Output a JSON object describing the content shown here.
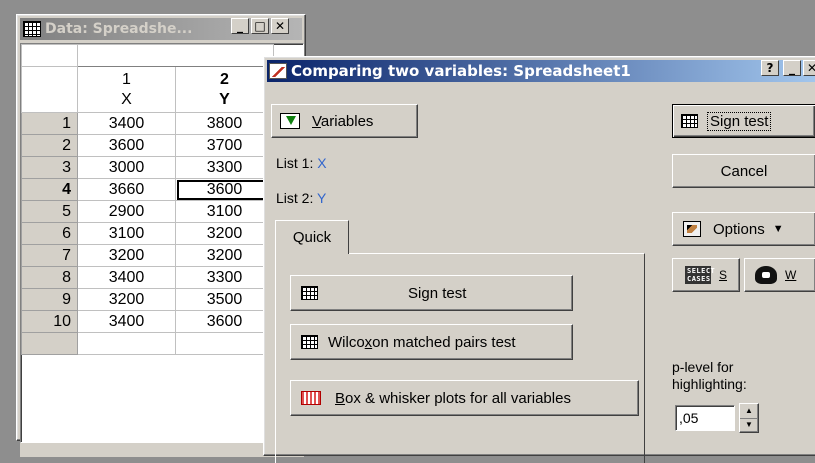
{
  "spreadsheet_window": {
    "title": "Data: Spreadshe...",
    "titlebar_buttons": [
      "_",
      "□",
      "✕"
    ],
    "columns": [
      {
        "number": "1",
        "name": "X"
      },
      {
        "number": "2",
        "name": "Y"
      }
    ],
    "rows": [
      {
        "num": "1",
        "x": "3400",
        "y": "3800"
      },
      {
        "num": "2",
        "x": "3600",
        "y": "3700"
      },
      {
        "num": "3",
        "x": "3000",
        "y": "3300"
      },
      {
        "num": "4",
        "x": "3660",
        "y": "3600"
      },
      {
        "num": "5",
        "x": "2900",
        "y": "3100"
      },
      {
        "num": "6",
        "x": "3100",
        "y": "3200"
      },
      {
        "num": "7",
        "x": "3200",
        "y": "3200"
      },
      {
        "num": "8",
        "x": "3400",
        "y": "3300"
      },
      {
        "num": "9",
        "x": "3200",
        "y": "3500"
      },
      {
        "num": "10",
        "x": "3400",
        "y": "3600"
      }
    ]
  },
  "dialog": {
    "title": "Comparing two variables: Spreadsheet1",
    "titlebar_buttons": [
      "?",
      "_",
      "✕"
    ],
    "variables_button": {
      "mnemonic": "V",
      "rest": "ariables"
    },
    "list1": {
      "label": "List 1:",
      "value": "X"
    },
    "list2": {
      "label": "List 2:",
      "value": "Y"
    },
    "tab_quick": "Quick",
    "sign_test_button": {
      "before": "Si",
      "mnemonic": "g",
      "after": "n test"
    },
    "wilcoxon_button": {
      "before": "Wilco",
      "mnemonic": "x",
      "after": "on matched pairs test"
    },
    "boxplot_button": {
      "mnemonic": "B",
      "rest": "ox & whisker plots for all variables"
    },
    "right_sign_test_button": {
      "before": "Si",
      "mnemonic": "g",
      "after": "n test"
    },
    "cancel_button": "Cancel",
    "options_button": "Options",
    "select_cases_icon_text": "SELECT CASES",
    "select_cases_label": "S",
    "weight_label": "W",
    "plevel_label_line1": "p-level for",
    "plevel_label_line2": "highlighting:",
    "plevel_value": ",05"
  }
}
